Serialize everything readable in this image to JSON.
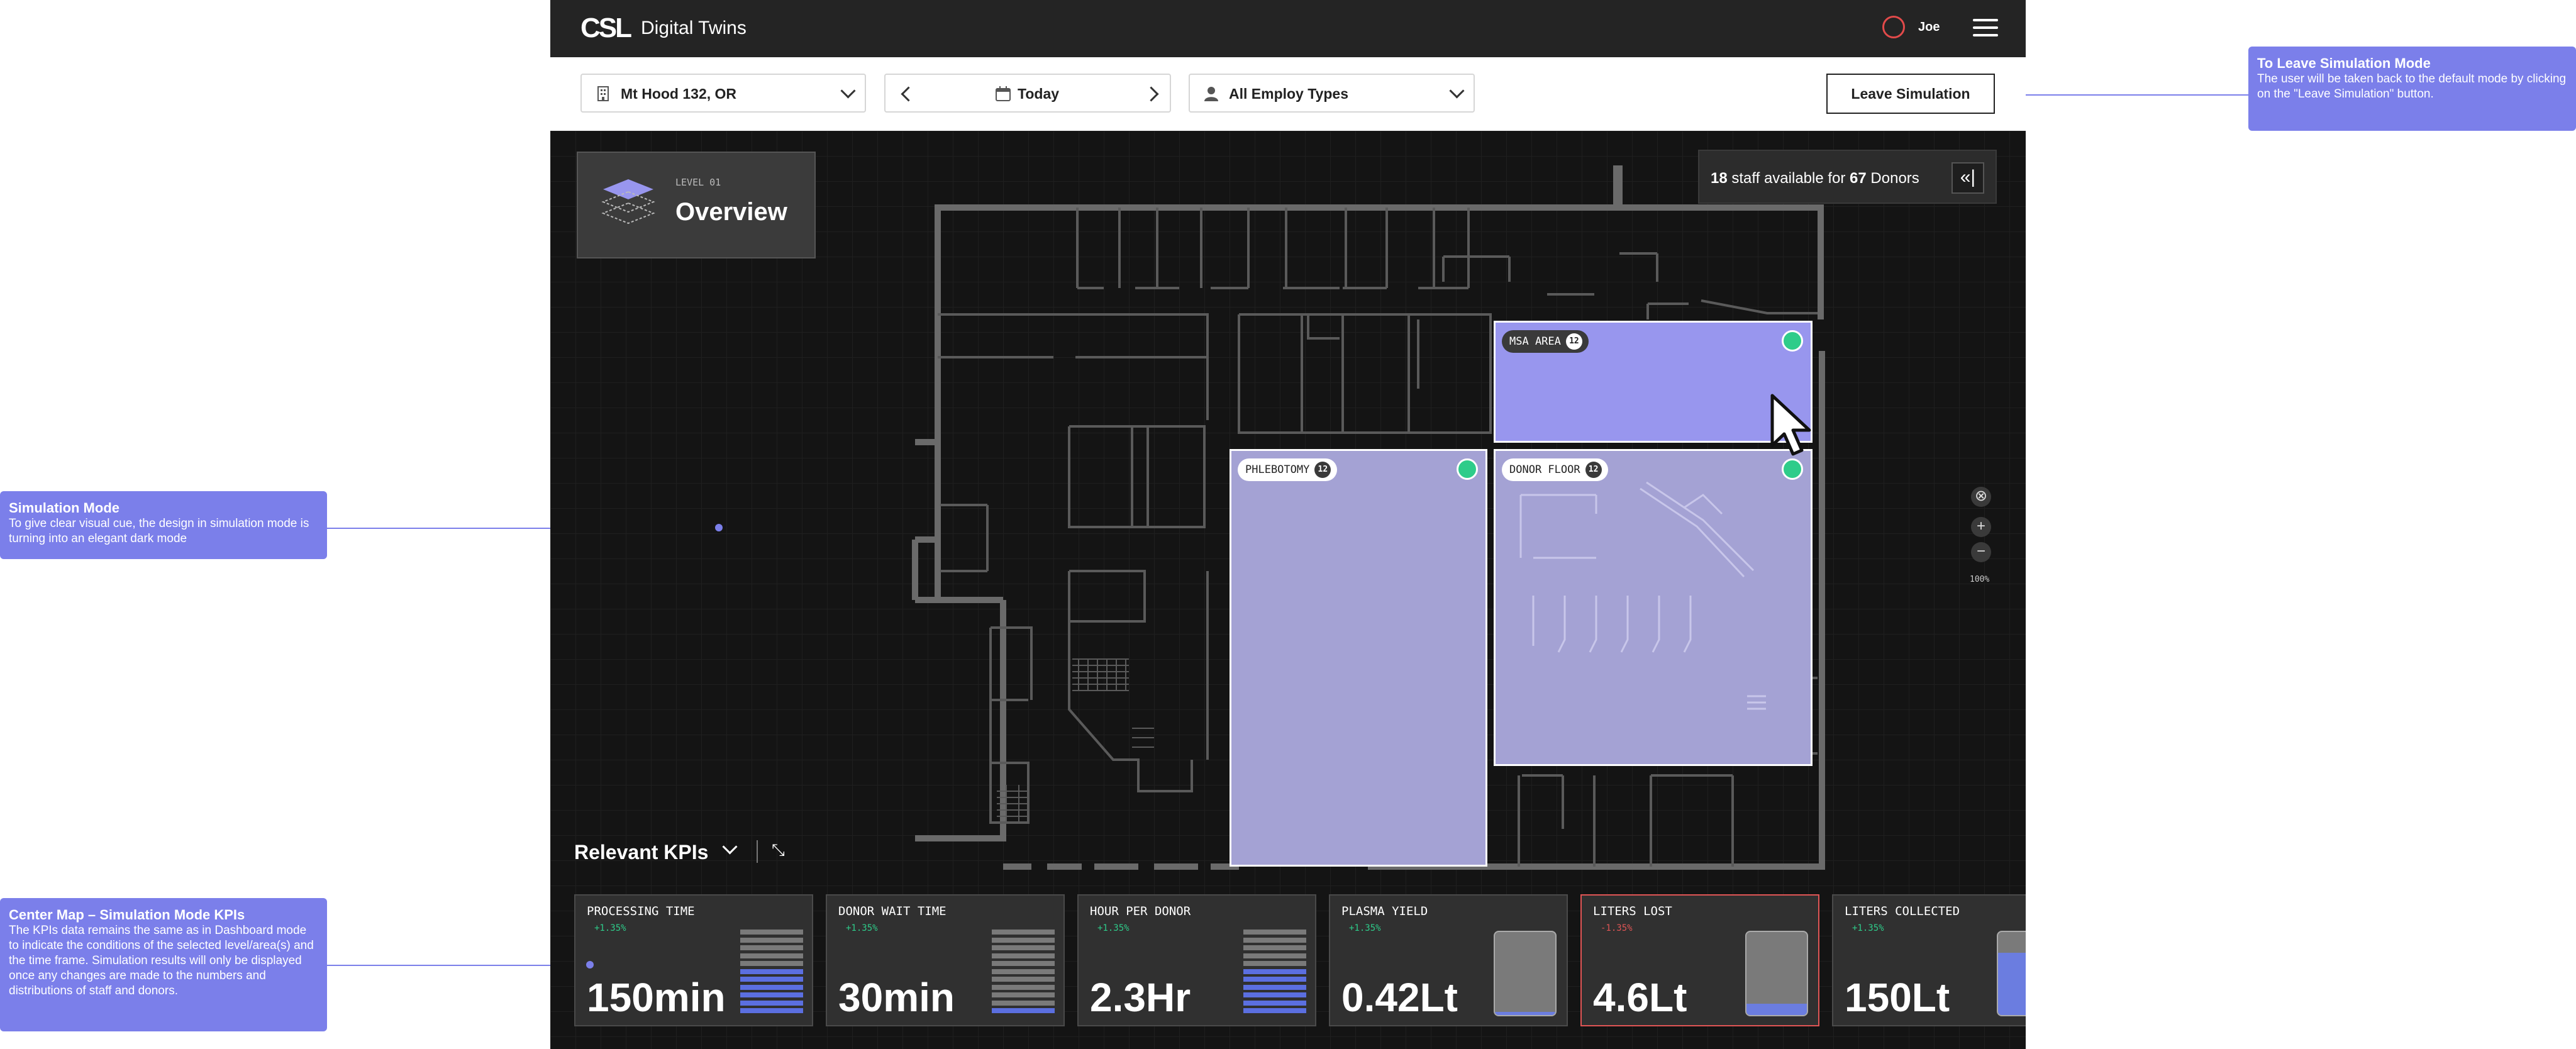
{
  "header": {
    "logo": "CSL",
    "title": "Digital Twins",
    "user": "Joe"
  },
  "filters": {
    "location": "Mt Hood 132, OR",
    "date": "Today",
    "employee_type": "All Employ Types",
    "leave_button": "Leave Simulation"
  },
  "level_card": {
    "level": "LEVEL 01",
    "title": "Overview"
  },
  "staff_summary": {
    "staff": "18",
    "text_mid": "staff available for",
    "donors": "67",
    "text_end": "Donors"
  },
  "zoom": {
    "level": "100%"
  },
  "areas": [
    {
      "name": "MSA AREA",
      "count": "12",
      "color": "#9896ee",
      "tag_style": "dark"
    },
    {
      "name": "PHLEBOTOMY",
      "count": "12",
      "color": "#a4a2d4",
      "tag_style": "light"
    },
    {
      "name": "DONOR FLOOR",
      "count": "12",
      "color": "#a4a2d4",
      "tag_style": "light"
    }
  ],
  "kpis": {
    "title": "Relevant KPIs",
    "items": [
      {
        "title": "PROCESSING TIME",
        "change": "+1.35%",
        "value": "150min",
        "trend": "up",
        "visual": "stack",
        "level": 0.55
      },
      {
        "title": "DONOR WAIT TIME",
        "change": "+1.35%",
        "value": "30min",
        "trend": "up",
        "visual": "stack",
        "level": 0.1
      },
      {
        "title": "HOUR PER DONOR",
        "change": "+1.35%",
        "value": "2.3Hr",
        "trend": "up",
        "visual": "stack",
        "level": 0.55
      },
      {
        "title": "PLASMA YIELD",
        "change": "+1.35%",
        "value": "0.42Lt",
        "trend": "up",
        "visual": "tank",
        "level": 0.04
      },
      {
        "title": "LITERS LOST",
        "change": "-1.35%",
        "value": "4.6Lt",
        "trend": "down",
        "visual": "tank",
        "level": 0.14,
        "alert": true
      },
      {
        "title": "LITERS COLLECTED",
        "change": "+1.35%",
        "value": "150Lt",
        "trend": "up",
        "visual": "tank",
        "level": 0.75
      }
    ]
  },
  "annotations": [
    {
      "title": "To Leave Simulation Mode",
      "text": "The user will be taken back to the default mode by clicking on the \"Leave Simulation\" button."
    },
    {
      "title": "Simulation Mode",
      "text": "To give clear visual cue, the design in simulation mode is turning into an elegant dark mode"
    },
    {
      "title": "Center Map – Simulation Mode KPIs",
      "text": "The KPIs data remains the same as in Dashboard mode to indicate the conditions of the selected level/area(s) and the time frame. Simulation results will only be displayed once any changes are made to the numbers and distributions of staff and donors."
    }
  ],
  "colors": {
    "accent": "#7b7fea",
    "positive": "#2ecc8a",
    "negative": "#e05555",
    "bar_fill": "#5b6fe0",
    "bar_empty": "#7a7a7a"
  },
  "icons": [
    "building-icon",
    "calendar-icon",
    "user-icon",
    "chevron-down-icon",
    "chevron-left-icon",
    "chevron-right-icon",
    "menu-icon",
    "layers-icon",
    "collapse-panel-icon",
    "recenter-icon",
    "zoom-in-icon",
    "zoom-out-icon",
    "minimize-icon",
    "cursor-icon"
  ]
}
